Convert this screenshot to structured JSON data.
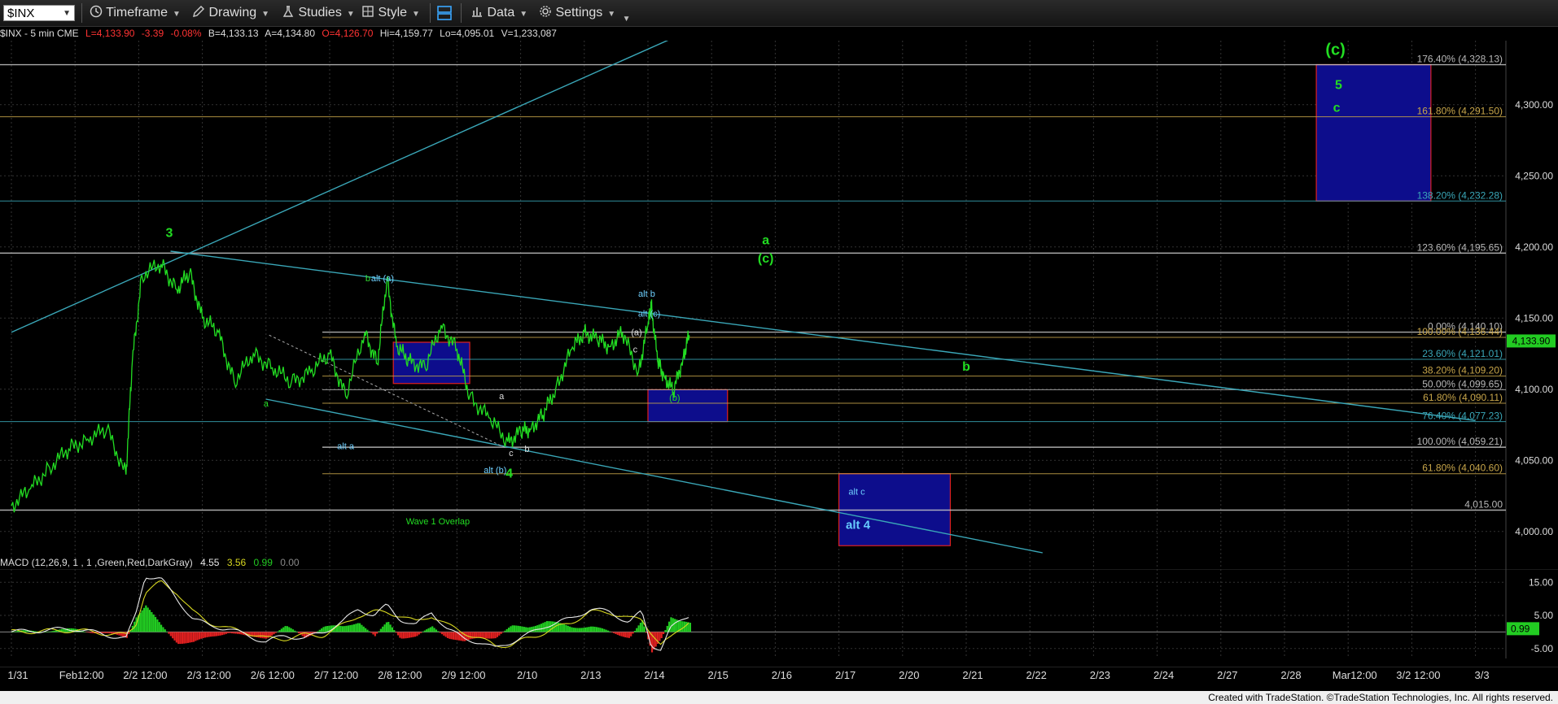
{
  "toolbar": {
    "symbol": "$INX",
    "items": [
      {
        "id": "timeframe",
        "label": "Timeframe",
        "icon": "clock-icon"
      },
      {
        "id": "drawing",
        "label": "Drawing",
        "icon": "pencil-icon"
      },
      {
        "id": "studies",
        "label": "Studies",
        "icon": "flask-icon"
      },
      {
        "id": "style",
        "label": "Style",
        "icon": "style-icon"
      },
      {
        "id": "data",
        "label": "Data",
        "icon": "bar-chart-icon"
      },
      {
        "id": "settings",
        "label": "Settings",
        "icon": "gear-icon"
      }
    ]
  },
  "infobar": {
    "symbol": "$INX - 5 min  CME",
    "last": "L=4,133.90",
    "change": "-3.39",
    "pct": "-0.08%",
    "bid": "B=4,133.13",
    "ask": "A=4,134.80",
    "open": "O=4,126.70",
    "high": "Hi=4,159.77",
    "low": "Lo=4,095.01",
    "volume": "V=1,233,087"
  },
  "colors": {
    "price": "#22dd22",
    "trend": "#3aa7b8",
    "fib": "#a8a8a8",
    "fib_gold": "#9a9a4a",
    "box_fill": "#0d0d8c",
    "box_border": "#e02020",
    "last_price_bg": "#22cc22",
    "macd_line": "#e8e8e8",
    "signal_line": "#d8d820",
    "hist_up": "#22cc22",
    "hist_down": "#e02020"
  },
  "chart_data": [
    {
      "type": "line",
      "title": "$INX - 5 min",
      "x_axis_labels": [
        "1/31",
        "Feb12:00",
        "2/2 12:00",
        "2/3 12:00",
        "2/6 12:00",
        "2/7 12:00",
        "2/8 12:00",
        "2/9 12:00",
        "2/10",
        "2/13",
        "2/14",
        "2/15",
        "2/16",
        "2/17",
        "2/20",
        "2/21",
        "2/22",
        "2/23",
        "2/24",
        "2/27",
        "2/28",
        "Mar12:00",
        "3/2 12:00",
        "3/3"
      ],
      "ylim": [
        3985,
        4345
      ],
      "y_ticks": [
        "4,300.00",
        "4,250.00",
        "4,200.00",
        "4,150.00",
        "4,100.00",
        "4,050.00",
        "4,000.00"
      ],
      "last_price": "4,133.90",
      "series": [
        {
          "x_index": [
            0,
            0.3,
            0.6,
            0.9,
            1.2,
            1.5,
            1.8,
            1.9,
            2.05,
            2.35,
            2.6,
            2.8,
            3.0,
            3.25,
            3.5,
            3.8,
            4.1,
            4.4,
            4.7,
            5.0,
            5.25,
            5.55,
            5.75,
            5.9,
            6.05,
            6.25,
            6.5,
            6.75,
            7.0,
            7.2,
            7.5,
            7.8,
            8.0,
            8.15,
            8.35,
            8.55,
            8.8,
            9.0,
            9.2,
            9.4,
            9.6,
            9.85,
            10.0,
            10.05,
            10.15,
            10.25,
            10.4,
            10.55,
            10.65
          ],
          "values": [
            4018,
            4030,
            4045,
            4058,
            4065,
            4072,
            4040,
            4120,
            4180,
            4188,
            4170,
            4182,
            4150,
            4140,
            4105,
            4125,
            4115,
            4105,
            4112,
            4125,
            4095,
            4140,
            4118,
            4178,
            4130,
            4120,
            4115,
            4145,
            4128,
            4095,
            4080,
            4063,
            4070,
            4072,
            4082,
            4100,
            4128,
            4140,
            4135,
            4130,
            4140,
            4112,
            4145,
            4160,
            4120,
            4110,
            4098,
            4122,
            4138
          ]
        }
      ],
      "wave_labels": [
        {
          "text": "3",
          "x_index": 2.48,
          "y": 4207
        },
        {
          "text": "a",
          "x_index": 4.0,
          "y": 4088
        },
        {
          "text": "b",
          "x_index": 5.6,
          "y": 4176
        },
        {
          "text": "alt (a)",
          "x_index": 5.83,
          "y": 4176
        },
        {
          "text": "alt a",
          "x_index": 5.25,
          "y": 4058
        },
        {
          "text": "a",
          "x_index": 7.7,
          "y": 4093
        },
        {
          "text": "alt (b)",
          "x_index": 7.6,
          "y": 4041
        },
        {
          "text": "c",
          "x_index": 7.85,
          "y": 4053
        },
        {
          "text": "4",
          "x_index": 7.82,
          "y": 4038
        },
        {
          "text": "b",
          "x_index": 8.1,
          "y": 4056
        },
        {
          "text": "alt b",
          "x_index": 9.98,
          "y": 4165
        },
        {
          "text": "alt (c)",
          "x_index": 10.02,
          "y": 4151
        },
        {
          "text": "(a)",
          "x_index": 9.82,
          "y": 4138
        },
        {
          "text": "c",
          "x_index": 9.8,
          "y": 4126
        },
        {
          "text": "(b)",
          "x_index": 10.42,
          "y": 4092
        },
        {
          "text": "a",
          "x_index": 11.85,
          "y": 4202
        },
        {
          "text": "(c)",
          "x_index": 11.85,
          "y": 4189
        },
        {
          "text": "b",
          "x_index": 15.0,
          "y": 4113
        },
        {
          "text": "Wave 1 Overlap",
          "x_index": 6.7,
          "y": 4005
        },
        {
          "text": "alt c",
          "x_index": 13.28,
          "y": 4026
        },
        {
          "text": "alt 4",
          "x_index": 13.3,
          "y": 4002
        },
        {
          "text": "(c)",
          "x_index": 20.8,
          "y": 4335
        },
        {
          "text": "5",
          "x_index": 20.85,
          "y": 4311
        },
        {
          "text": "c",
          "x_index": 20.82,
          "y": 4295
        }
      ],
      "fib_levels": [
        {
          "label": "176.40% (4,328.13)",
          "value": 4328.13
        },
        {
          "label": "161.80% (4,291.50)",
          "value": 4291.5
        },
        {
          "label": "138.20% (4,232.28)",
          "value": 4232.28
        },
        {
          "label": "123.60% (4,195.65)",
          "value": 4195.65
        },
        {
          "label": "0.00% (4,140.10)",
          "value": 4140.1
        },
        {
          "label": "100.00% (4,136.44)",
          "value": 4136.44
        },
        {
          "label": "23.60% (4,121.01)",
          "value": 4121.01
        },
        {
          "label": "38.20% (4,109.20)",
          "value": 4109.2
        },
        {
          "label": "50.00% (4,099.65)",
          "value": 4099.65
        },
        {
          "label": "61.80% (4,090.11)",
          "value": 4090.11
        },
        {
          "label": "76.40% (4,077.23)",
          "value": 4077.23
        },
        {
          "label": "100.00% (4,059.21)",
          "value": 4059.21
        },
        {
          "label": "61.80% (4,040.60)",
          "value": 4040.6
        },
        {
          "label": "4,015.00",
          "value": 4015.0
        }
      ],
      "target_boxes": [
        {
          "name": "5-target",
          "x_index": [
            20.5,
            22.3
          ],
          "y": [
            4232.28,
            4328.13
          ]
        },
        {
          "name": "alt-4-target",
          "x_index": [
            13.0,
            14.75
          ],
          "y": [
            3990,
            4040.6
          ]
        },
        {
          "name": "b-target",
          "x_index": [
            10.0,
            11.25
          ],
          "y": [
            4077.23,
            4099.65
          ]
        },
        {
          "name": "alt-a-box",
          "x_index": [
            6.0,
            7.2
          ],
          "y": [
            4104,
            4133
          ]
        }
      ],
      "trend_lines": [
        {
          "name": "upper-channel",
          "from": [
            0,
            4140
          ],
          "to": [
            10.4,
            4347
          ]
        },
        {
          "name": "top-resistance",
          "from": [
            2.5,
            4197
          ],
          "to": [
            23.0,
            4078
          ]
        },
        {
          "name": "lower-channel",
          "from": [
            4.0,
            4093
          ],
          "to": [
            16.2,
            3985
          ]
        }
      ]
    },
    {
      "type": "line",
      "title": "MACD (12,26,9, 1 , 1 ,Green,Red,DarkGray)",
      "legend": {
        "macd": "4.55",
        "signal": "3.56",
        "hist": "0.99",
        "zero": "0.00"
      },
      "ylim": [
        -8,
        19
      ],
      "y_ticks": [
        "15.00",
        "5.00",
        "-5.00"
      ],
      "last_value": "0.99",
      "series": [
        {
          "name": "MACD",
          "x_index": [
            0,
            1,
            1.8,
            1.95,
            2.1,
            2.35,
            2.6,
            2.85,
            3.1,
            3.4,
            3.7,
            4.0,
            4.3,
            4.6,
            4.9,
            5.2,
            5.45,
            5.7,
            5.9,
            6.1,
            6.35,
            6.6,
            6.85,
            7.1,
            7.35,
            7.6,
            7.85,
            8.1,
            8.4,
            8.8,
            9.1,
            9.4,
            9.7,
            9.9,
            10.05,
            10.2,
            10.35,
            10.5,
            10.65
          ],
          "values": [
            0,
            1,
            -2,
            5,
            17,
            16,
            10,
            4,
            2,
            1,
            -1,
            -3,
            -1,
            -2,
            0,
            3,
            7,
            5,
            8,
            4,
            2,
            6,
            1,
            -2,
            -3,
            -5,
            -3,
            -1,
            2,
            4,
            7,
            6,
            3,
            6,
            -4,
            -5,
            1,
            3,
            5
          ]
        },
        {
          "name": "Signal",
          "x_index": [
            0,
            1,
            1.8,
            1.95,
            2.1,
            2.35,
            2.6,
            2.85,
            3.1,
            3.4,
            3.7,
            4.0,
            4.3,
            4.6,
            4.9,
            5.2,
            5.45,
            5.7,
            5.9,
            6.1,
            6.35,
            6.6,
            6.85,
            7.1,
            7.35,
            7.6,
            7.85,
            8.1,
            8.4,
            8.8,
            9.1,
            9.4,
            9.7,
            9.9,
            10.05,
            10.2,
            10.35,
            10.5,
            10.65
          ],
          "values": [
            0,
            0.5,
            -1,
            2,
            12,
            15,
            12,
            6,
            3,
            1,
            0,
            -2,
            -2,
            -1,
            -1,
            2,
            5,
            6,
            6,
            5,
            3,
            5,
            2,
            0,
            -2,
            -4,
            -4,
            -2,
            0,
            3,
            6,
            6,
            4,
            4,
            0,
            -4,
            -2,
            1,
            3.5
          ]
        }
      ]
    }
  ],
  "footer": "Created with TradeStation. ©TradeStation Technologies, Inc. All rights reserved."
}
